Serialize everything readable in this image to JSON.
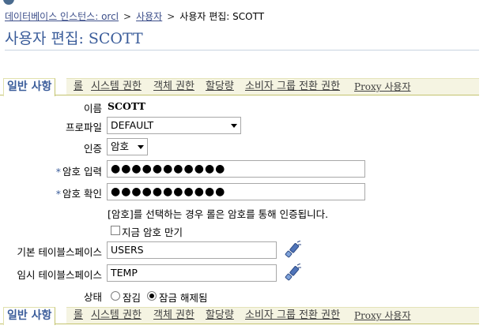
{
  "breadcrumb": {
    "db_instance": "데이터베이스 인스턴스: orcl",
    "users": "사용자",
    "current": "사용자 편집: SCOTT",
    "sep": ">"
  },
  "page_title": "사용자 편집: SCOTT",
  "tabs": [
    {
      "label": "일반 사항",
      "active": true
    },
    {
      "label": "롤"
    },
    {
      "label": "시스템 권한"
    },
    {
      "label": "객체 권한"
    },
    {
      "label": "할당량"
    },
    {
      "label": "소비자 그룹 전환 권한"
    },
    {
      "label": "Proxy 사용자"
    }
  ],
  "form": {
    "name_label": "이름",
    "name_value": "SCOTT",
    "profile_label": "프로파일",
    "profile_value": "DEFAULT",
    "auth_label": "인증",
    "auth_value": "암호",
    "pw_label": "암호 입력",
    "pw_value": "●●●●●●●●●●●",
    "pw_confirm_label": "암호 확인",
    "pw_confirm_value": "●●●●●●●●●●●",
    "auth_note": "[암호]를 선택하는 경우 롤은 암호를 통해 인증됩니다.",
    "expire_label": "지금 암호 만기",
    "default_ts_label": "기본 테이블스페이스",
    "default_ts_value": "USERS",
    "temp_ts_label": "임시 테이블스페이스",
    "temp_ts_value": "TEMP",
    "status_label": "상태",
    "status_locked": "잠김",
    "status_unlocked": "잠금 해제됨",
    "required_mark": "*"
  },
  "colors": {
    "accent": "#3a5c9a",
    "tab_border": "#c3c36e",
    "tab_bg": "#f5f4e2"
  }
}
